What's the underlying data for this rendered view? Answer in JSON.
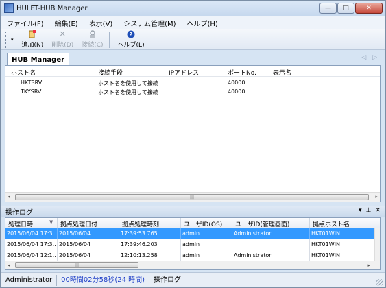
{
  "window": {
    "title": "HULFT-HUB Manager",
    "minimize": "—",
    "maximize": "□",
    "close": "✕"
  },
  "menu": {
    "items": [
      "ファイル(F)",
      "編集(E)",
      "表示(V)",
      "システム管理(M)",
      "ヘルプ(H)"
    ]
  },
  "toolbar": {
    "dropdown": "▾",
    "add": {
      "label": "追加(N)",
      "icon": "add-document-icon"
    },
    "delete": {
      "label": "削除(D)",
      "icon": "delete-x-icon"
    },
    "connect": {
      "label": "接続(C)",
      "icon": "connect-icon"
    },
    "help": {
      "label": "ヘルプ(L)",
      "icon": "help-icon"
    }
  },
  "tabs": {
    "active": "HUB Manager",
    "nav": "◁ ▷"
  },
  "hosts": {
    "columns": [
      "ホスト名",
      "接続手段",
      "IPアドレス",
      "ポートNo.",
      "表示名"
    ],
    "rows": [
      {
        "host": "HKTSRV",
        "method": "ホスト名を使用して接続",
        "ip": "",
        "port": "40000",
        "display": ""
      },
      {
        "host": "TKYSRV",
        "method": "ホスト名を使用して接続",
        "ip": "",
        "port": "40000",
        "display": ""
      }
    ],
    "scroll_left": "◂",
    "scroll_right": "▸",
    "scroll_thumb": "|||"
  },
  "oplog": {
    "title": "操作ログ",
    "controls": [
      "▾",
      "⊥",
      "✕"
    ],
    "columns": [
      "処理日時",
      "拠点処理日付",
      "拠点処理時刻",
      "ユーザID(OS)",
      "ユーザID(管理画面)",
      "拠点ホスト名"
    ],
    "sort_indicator": "▼",
    "rows": [
      {
        "datetime": "2015/06/04 17:3...",
        "date": "2015/06/04",
        "time": "17:39:53.765",
        "os_user": "admin",
        "admin_user": "Administrator",
        "host": "HKT01WIN",
        "selected": true
      },
      {
        "datetime": "2015/06/04 17:3...",
        "date": "2015/06/04",
        "time": "17:39:46.203",
        "os_user": "admin",
        "admin_user": "",
        "host": "HKT01WIN",
        "selected": false
      },
      {
        "datetime": "2015/06/04 12:1...",
        "date": "2015/06/04",
        "time": "12:10:13.258",
        "os_user": "admin",
        "admin_user": "Administrator",
        "host": "HKT01WIN",
        "selected": false
      }
    ],
    "scroll_thumb": "|||"
  },
  "status": {
    "user": "Administrator",
    "elapsed": "00時間02分58秒(24 時間)",
    "pane": "操作ログ"
  }
}
